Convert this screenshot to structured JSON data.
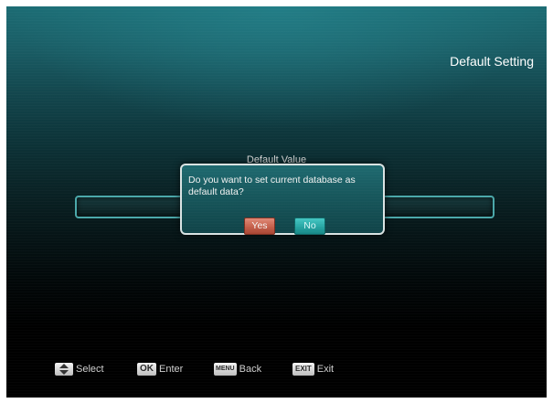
{
  "header": {
    "title": "Default Setting"
  },
  "main": {
    "field_label": "Default Value"
  },
  "dialog": {
    "message": "Do you want to set current database as default data?",
    "yes_label": "Yes",
    "no_label": "No"
  },
  "footer": {
    "hints": [
      {
        "key": "",
        "icon": "up-down-arrows-icon",
        "label": "Select"
      },
      {
        "key": "OK",
        "label": "Enter"
      },
      {
        "key": "MENU",
        "label": "Back"
      },
      {
        "key": "EXIT",
        "label": "Exit"
      }
    ]
  },
  "colors": {
    "accent_teal": "#27a5a3",
    "yes_button": "#c55f4a",
    "dialog_border": "#d9e3e3"
  }
}
